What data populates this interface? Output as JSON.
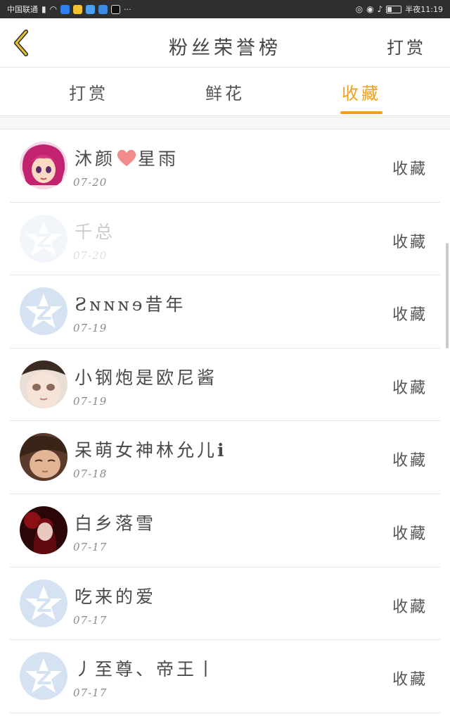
{
  "status_bar": {
    "carrier": "中国联通",
    "net_badge": "4G",
    "more": "···",
    "time": "半夜11:19"
  },
  "header": {
    "title": "粉丝荣誉榜",
    "action": "打赏"
  },
  "tabs": [
    {
      "label": "打赏",
      "active": false
    },
    {
      "label": "鲜花",
      "active": false
    },
    {
      "label": "收藏",
      "active": true
    }
  ],
  "accent_color": "#f0a01c",
  "fans": [
    {
      "name": "沐颜",
      "name_suffix": "星雨",
      "date": "07-20",
      "action": "收藏",
      "avatar": "anime-girl-pink-hair-avatar"
    },
    {
      "name": "千总",
      "date": "07-20",
      "action": "收藏",
      "avatar": "default-star-avatar"
    },
    {
      "name": "Ƨɴɴɴɘ昔年",
      "date": "07-19",
      "action": "收藏",
      "avatar": "default-star-avatar"
    },
    {
      "name": "小钢炮是欧尼酱",
      "date": "07-19",
      "action": "收藏",
      "avatar": "doll-face-avatar"
    },
    {
      "name": "呆萌女神林允儿ℹ",
      "date": "07-18",
      "action": "收藏",
      "avatar": "girl-photo-avatar"
    },
    {
      "name": "白乡落雪",
      "date": "07-17",
      "action": "收藏",
      "avatar": "dark-red-anime-avatar"
    },
    {
      "name": "吃来的爱",
      "date": "07-17",
      "action": "收藏",
      "avatar": "default-star-avatar"
    },
    {
      "name": "丿至尊、帝王丨",
      "date": "07-17",
      "action": "收藏",
      "avatar": "default-star-avatar"
    }
  ]
}
